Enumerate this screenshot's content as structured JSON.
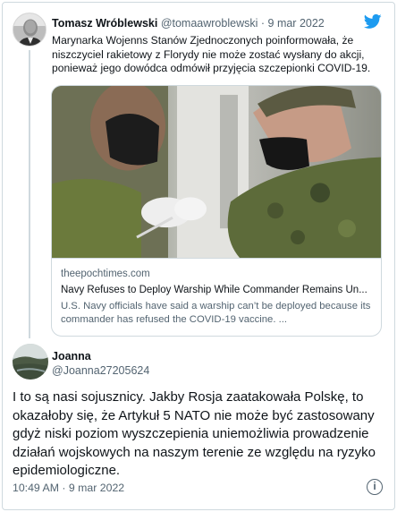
{
  "colors": {
    "twitter_blue": "#1d9bf0",
    "text_primary": "#0f1419",
    "text_secondary": "#536471",
    "border": "#cfd9de"
  },
  "quoted_tweet": {
    "author_name": "Tomasz Wróblewski",
    "handle": "@tomaawroblewski",
    "separator": "·",
    "date": "9 mar 2022",
    "text": "Marynarka Wojenns Stanów Zjednoczonych poinformowała, że niszczyciel rakietowy z Florydy nie może zostać wysłany do akcji, ponieważ jego dowódca odmówił przyjęcia szczepionki COVID-19.",
    "avatar_icon": "profile-photo",
    "brand_icon": "twitter-bird-icon",
    "card": {
      "domain": "theepochtimes.com",
      "title": "Navy Refuses to Deploy Warship While Commander Remains Un...",
      "description": "U.S. Navy officials have said a warship can’t be deployed because its commander has refused the COVID-19 vaccine. ...",
      "image_icon": "vaccination-photo"
    }
  },
  "tweet": {
    "author_name": "Joanna",
    "handle": "@Joanna27205624",
    "text": "I to są nasi sojusznicy. Jakby Rosja zaatakowała Polskę, to okazałoby się, że Artykuł 5 NATO nie może być zastosowany gdyż niski poziom wyszczepienia uniemożliwia prowadzenie działań wojskowych na naszym terenie ze względu na ryzyko epidemiologiczne.",
    "time": "10:49 AM",
    "separator": "·",
    "date": "9 mar 2022",
    "info_glyph": "i",
    "avatar_icon": "landscape-photo",
    "info_icon": "info-icon"
  }
}
